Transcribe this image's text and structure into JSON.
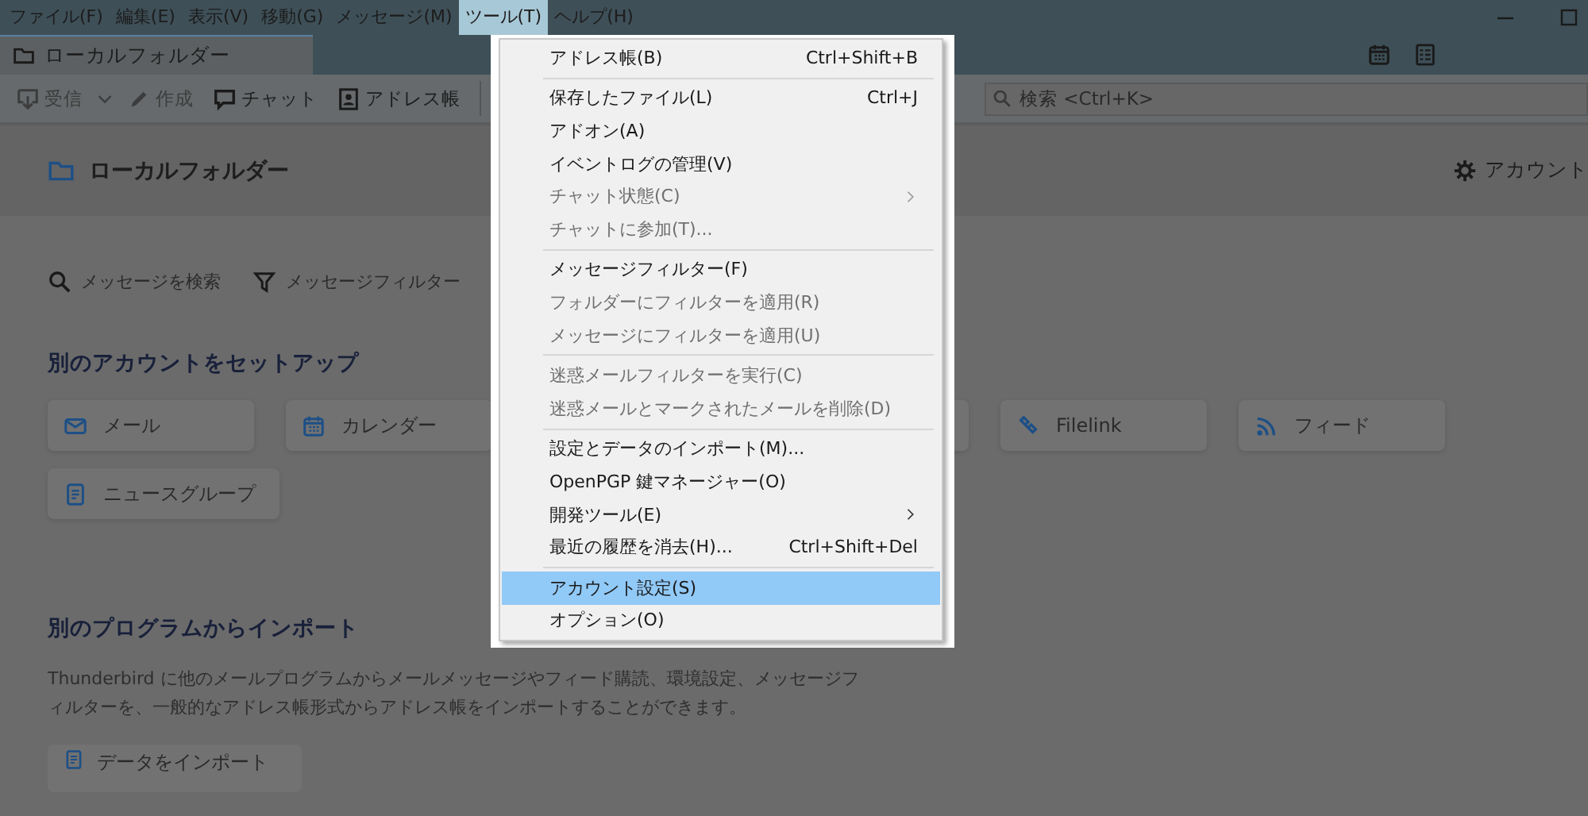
{
  "menubar": [
    {
      "label": "ファイル(F)",
      "selected": false
    },
    {
      "label": "編集(E)",
      "selected": false
    },
    {
      "label": "表示(V)",
      "selected": false
    },
    {
      "label": "移動(G)",
      "selected": false
    },
    {
      "label": "メッセージ(M)",
      "selected": false
    },
    {
      "label": "ツール(T)",
      "selected": true
    },
    {
      "label": "ヘルプ(H)",
      "selected": false
    }
  ],
  "tab": {
    "title": "ローカルフォルダー"
  },
  "toolbar": {
    "buttons": [
      {
        "label": "受信",
        "disabled": true
      },
      {
        "label": "作成",
        "disabled": true
      },
      {
        "label": "チャット",
        "disabled": false
      },
      {
        "label": "アドレス帳",
        "disabled": false
      }
    ],
    "search": {
      "placeholder": "検索 <Ctrl+K>"
    }
  },
  "header": {
    "title": "ローカルフォルダー",
    "settings_label": "アカウント"
  },
  "actions": [
    {
      "label": "メッセージを検索"
    },
    {
      "label": "メッセージフィルター"
    }
  ],
  "setup": {
    "title": "別のアカウントをセットアップ",
    "cards": [
      {
        "label": "メール"
      },
      {
        "label": "カレンダー"
      },
      {
        "label": "Filelink"
      },
      {
        "label": "フィード"
      },
      {
        "label": "ニュースグループ"
      }
    ]
  },
  "import": {
    "title": "別のプログラムからインポート",
    "description": "Thunderbird に他のメールプログラムからメールメッセージやフィード購読、環境設定、メッセージフィルターを、一般的なアドレス帳形式からアドレス帳をインポートすることができます。",
    "button": "データをインポート"
  },
  "menu": {
    "items": [
      {
        "kind": "item",
        "label": "アドレス帳(B)",
        "shortcut": "Ctrl+Shift+B",
        "disabled": false,
        "submenu": false,
        "selected": false
      },
      {
        "kind": "separator"
      },
      {
        "kind": "item",
        "label": "保存したファイル(L)",
        "shortcut": "Ctrl+J",
        "disabled": false,
        "submenu": false,
        "selected": false
      },
      {
        "kind": "item",
        "label": "アドオン(A)",
        "disabled": false,
        "submenu": false,
        "selected": false
      },
      {
        "kind": "item",
        "label": "イベントログの管理(V)",
        "disabled": false,
        "submenu": false,
        "selected": false
      },
      {
        "kind": "item",
        "label": "チャット状態(C)",
        "disabled": true,
        "submenu": true,
        "selected": false
      },
      {
        "kind": "item",
        "label": "チャットに参加(T)...",
        "disabled": true,
        "submenu": false,
        "selected": false
      },
      {
        "kind": "separator"
      },
      {
        "kind": "item",
        "label": "メッセージフィルター(F)",
        "disabled": false,
        "submenu": false,
        "selected": false
      },
      {
        "kind": "item",
        "label": "フォルダーにフィルターを適用(R)",
        "disabled": true,
        "submenu": false,
        "selected": false
      },
      {
        "kind": "item",
        "label": "メッセージにフィルターを適用(U)",
        "disabled": true,
        "submenu": false,
        "selected": false
      },
      {
        "kind": "separator"
      },
      {
        "kind": "item",
        "label": "迷惑メールフィルターを実行(C)",
        "disabled": true,
        "submenu": false,
        "selected": false
      },
      {
        "kind": "item",
        "label": "迷惑メールとマークされたメールを削除(D)",
        "disabled": true,
        "submenu": false,
        "selected": false
      },
      {
        "kind": "separator"
      },
      {
        "kind": "item",
        "label": "設定とデータのインポート(M)...",
        "disabled": false,
        "submenu": false,
        "selected": false
      },
      {
        "kind": "item",
        "label": "OpenPGP 鍵マネージャー(O)",
        "disabled": false,
        "submenu": false,
        "selected": false
      },
      {
        "kind": "item",
        "label": "開発ツール(E)",
        "disabled": false,
        "submenu": true,
        "selected": false
      },
      {
        "kind": "item",
        "label": "最近の履歴を消去(H)...",
        "shortcut": "Ctrl+Shift+Del",
        "disabled": false,
        "submenu": false,
        "selected": false
      },
      {
        "kind": "separator"
      },
      {
        "kind": "item",
        "label": "アカウント設定(S)",
        "disabled": false,
        "submenu": false,
        "selected": true
      },
      {
        "kind": "item",
        "label": "オプション(O)",
        "disabled": false,
        "submenu": false,
        "selected": false
      }
    ]
  }
}
